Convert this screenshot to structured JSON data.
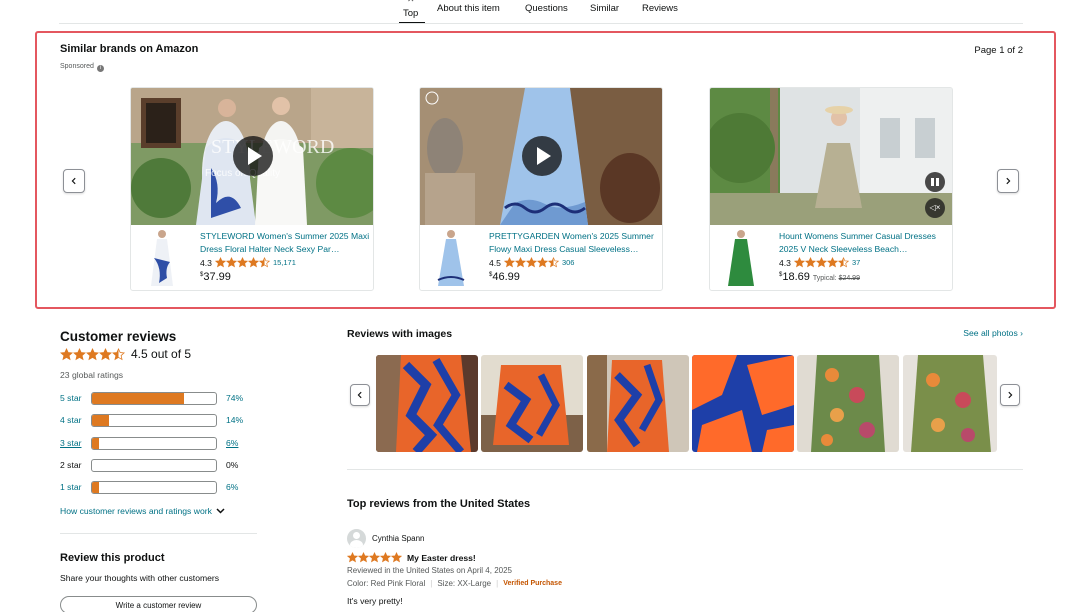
{
  "nav": {
    "active": "Top",
    "items": [
      "About this item",
      "Questions",
      "Similar",
      "Reviews"
    ]
  },
  "sponsored": {
    "title": "Similar brands on Amazon",
    "sponsored_label": "Sponsored",
    "page": "Page 1 of 2",
    "cards": [
      {
        "title": "STYLEWORD Women's Summer 2025 Maxi Dress Floral Halter Neck Sexy Par…",
        "rating": "4.3",
        "stars": 4.5,
        "count": "15,171",
        "price_symbol": "$",
        "price": "37.99",
        "video_overlay": "STYLEWORD",
        "video_tagline": "Focus on Quality"
      },
      {
        "title": "PRETTYGARDEN Women's 2025 Summer Flowy Maxi Dress Casual Sleeveless…",
        "rating": "4.5",
        "stars": 4.5,
        "count": "306",
        "price_symbol": "$",
        "price": "46.99"
      },
      {
        "title": "Hount Womens Summer Casual Dresses 2025 V Neck Sleeveless Beach…",
        "rating": "4.3",
        "stars": 4.5,
        "count": "37",
        "price_symbol": "$",
        "price": "18.69",
        "typical_label": "Typical:",
        "typical_price": "$24.99"
      }
    ]
  },
  "customer_reviews": {
    "title": "Customer reviews",
    "average": "4.5 out of 5",
    "stars": 4.5,
    "global_ratings": "23 global ratings",
    "histogram": [
      {
        "label": "5 star",
        "pct": "74%",
        "value": 74
      },
      {
        "label": "4 star",
        "pct": "14%",
        "value": 14
      },
      {
        "label": "3 star",
        "pct": "6%",
        "value": 6
      },
      {
        "label": "2 star",
        "pct": "0%",
        "value": 0
      },
      {
        "label": "1 star",
        "pct": "6%",
        "value": 6
      }
    ],
    "how_link": "How customer reviews and ratings work",
    "review_product_title": "Review this product",
    "review_product_sub": "Share your thoughts with other customers",
    "write_button": "Write a customer review"
  },
  "reviews_with_images": {
    "title": "Reviews with images",
    "see_all": "See all photos"
  },
  "top_reviews": {
    "title": "Top reviews from the United States",
    "review": {
      "author": "Cynthia Spann",
      "stars": 5,
      "headline": "My Easter dress!",
      "meta": "Reviewed in the United States on April 4, 2025",
      "color": "Color: Red Pink Floral",
      "size": "Size: XX-Large",
      "verified": "Verified Purchase",
      "text": "It's very pretty!"
    }
  },
  "colors": {
    "link": "#007185",
    "star": "#de7921",
    "highlight_border": "#e4575f"
  }
}
